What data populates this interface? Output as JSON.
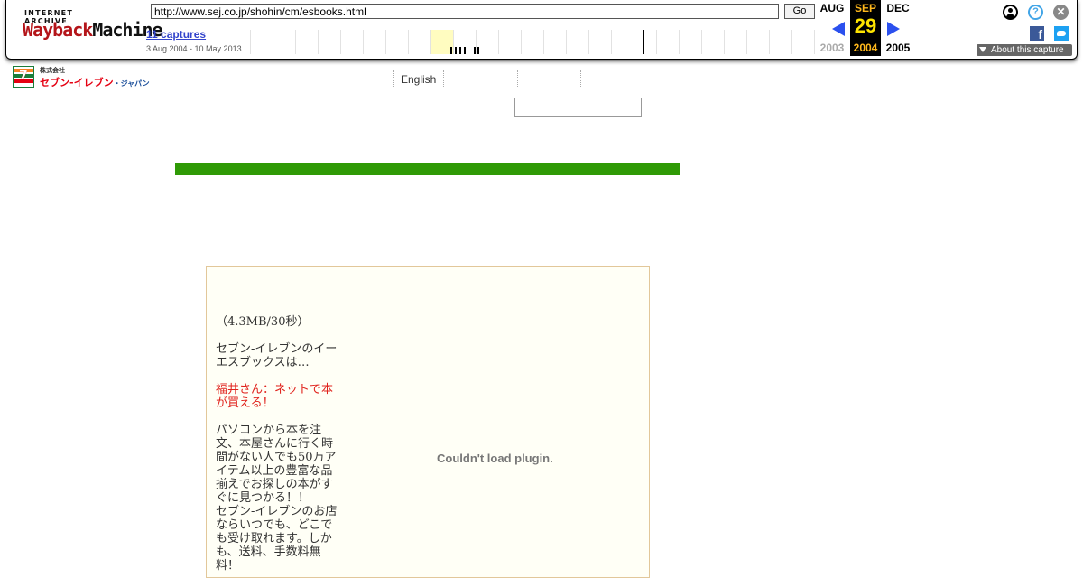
{
  "wayback": {
    "logo_top": "INTERNET ARCHIVE",
    "logo_main_1": "Wayback",
    "logo_main_2": "Machine",
    "url": "http://www.sej.co.jp/shohin/cm/esbooks.html",
    "go_label": "Go",
    "captures_label": "11 captures",
    "date_range": "3 Aug 2004 - 10 May 2013",
    "prev_month": "AUG",
    "prev_year": "2003",
    "current_month": "SEP",
    "current_day": "29",
    "current_year": "2004",
    "next_month": "DEC",
    "next_year": "2005",
    "help_glyph": "?",
    "close_glyph": "✕",
    "facebook_glyph": "f",
    "about_label": "About this capture",
    "colors": {
      "brand_red": "#b4151a",
      "arrow_blue": "#2b50ee",
      "current_bg": "#000000",
      "day_yellow": "#ffe400"
    }
  },
  "site": {
    "logo_company": "株式会社",
    "logo_name": "セブン-イレブン",
    "logo_suffix": "・ジャパン",
    "nav_english": "English",
    "search_value": "",
    "colors": {
      "green_bar": "#2f9a06",
      "accent_red": "#e0231d",
      "box_border": "#e2c79a",
      "box_bg": "#fffff6"
    }
  },
  "content": {
    "size_note": "（4.3MB/30秒）",
    "intro": "セブン-イレブンのイーエスブックスは…",
    "red_link": "福井さん：ネットで本が買える！",
    "body_1": "パソコンから本を注文、本屋さんに行く時間がない人でも50万アイテム以上の豊富な品揃えでお探しの本がすぐに見つかる！！",
    "body_2": "セブン-イレブンのお店ならいつでも、どこでも受け取れます。しかも、送料、手数料無料！",
    "plugin_message": "Couldn't load plugin."
  }
}
